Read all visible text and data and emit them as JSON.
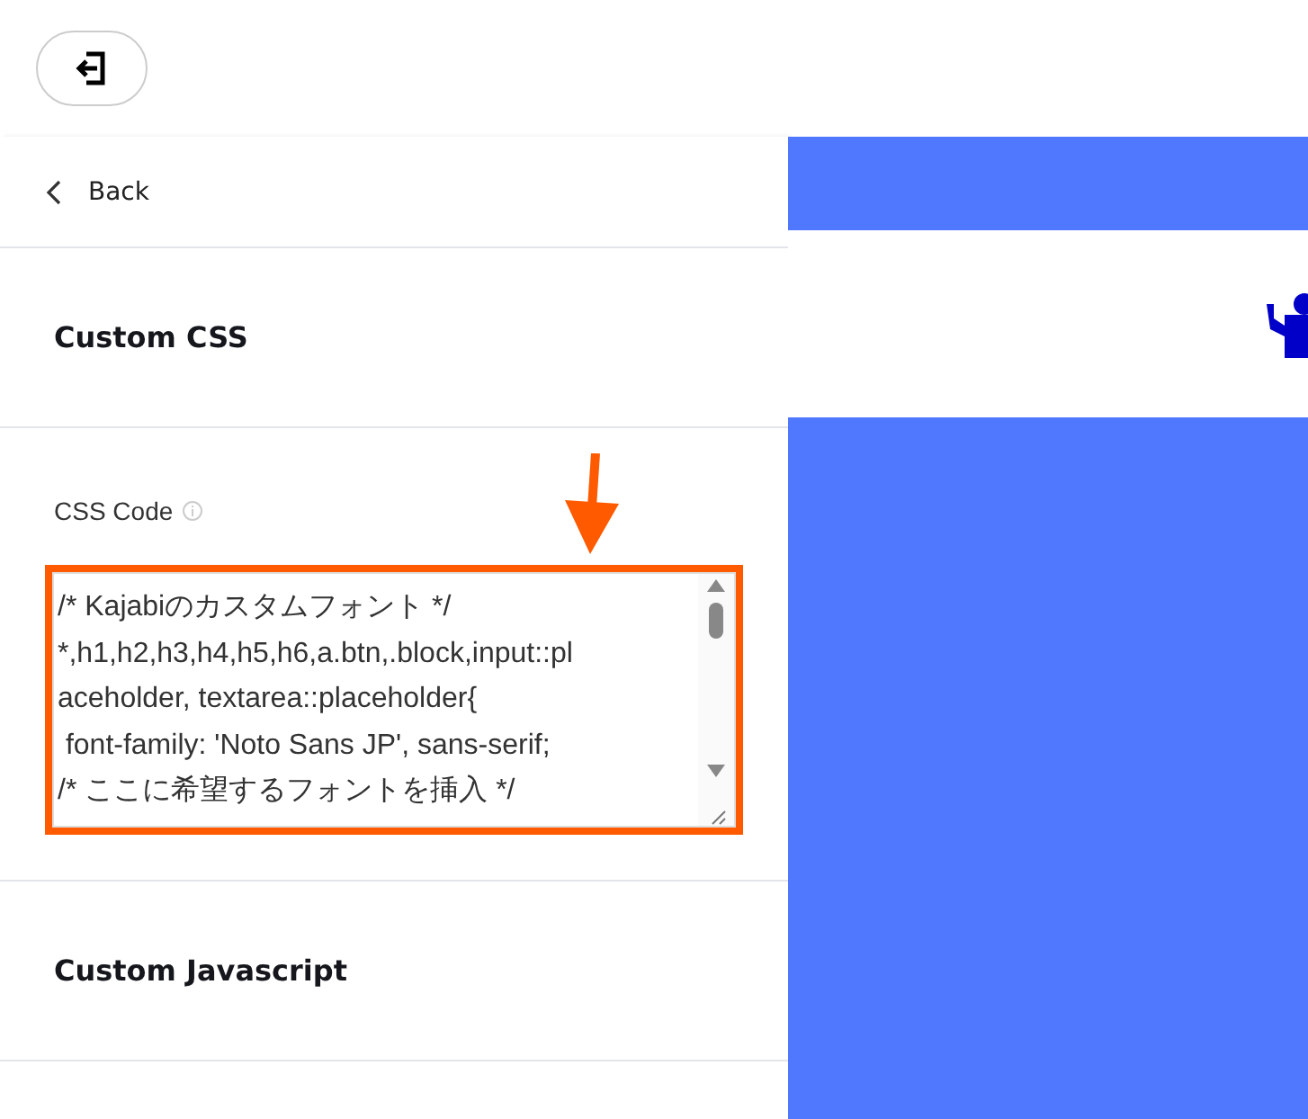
{
  "top_bar": {
    "exit_button": {
      "kind": "exit"
    }
  },
  "panel": {
    "back": {
      "label": "Back"
    },
    "sections": [
      {
        "kind": "heading",
        "title": "Custom CSS"
      },
      {
        "kind": "code",
        "label": "CSS Code",
        "lines": [
          "/* Kajabiのカスタムフォント */",
          "*,h1,h2,h3,h4,h5,h6,a.btn,.block,input::pl",
          "aceholder, textarea::placeholder{",
          " font-family: 'Noto Sans JP', sans-serif;",
          "/* ここに希望するフォントを挿入 */"
        ],
        "highlighted": true
      },
      {
        "kind": "heading",
        "title": "Custom Javascript"
      }
    ]
  },
  "preview": {
    "kind": "preview"
  }
}
